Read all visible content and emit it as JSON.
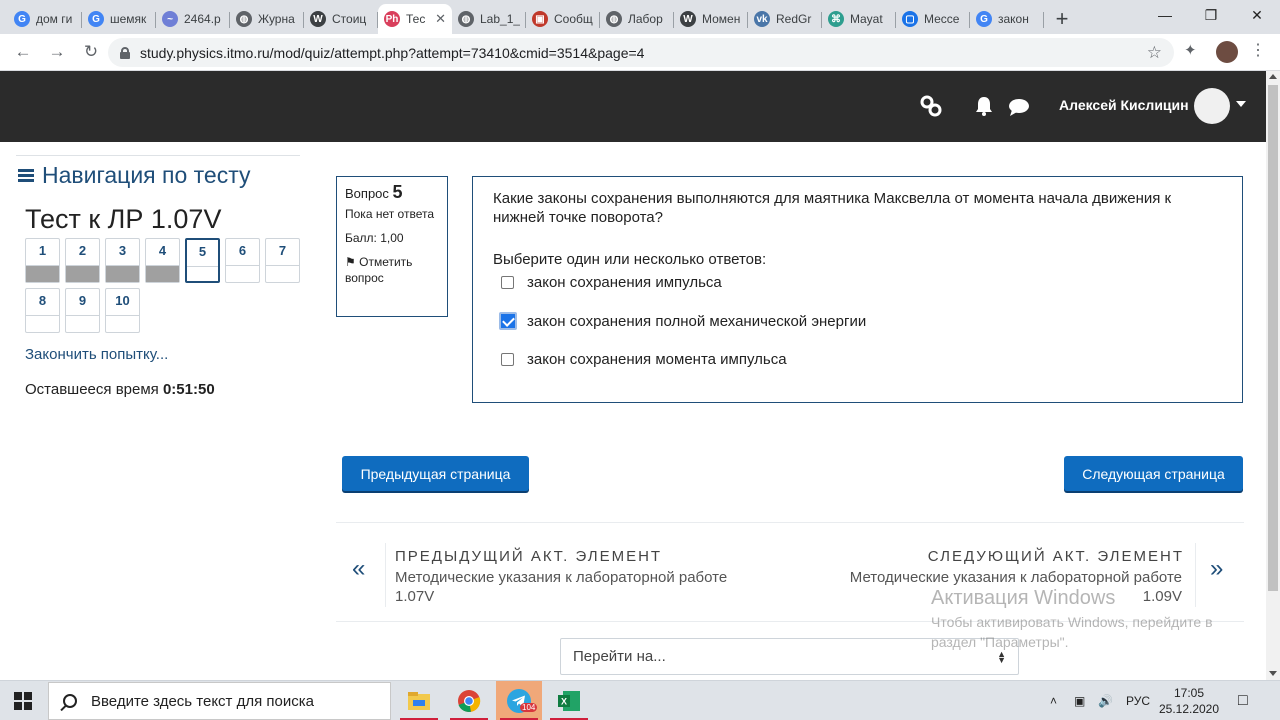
{
  "browser": {
    "tabs": [
      {
        "label": "дом ги",
        "icon": "google-icon",
        "color": "#4285f4",
        "glyph": "G"
      },
      {
        "label": "шемяк",
        "icon": "google-icon",
        "color": "#4285f4",
        "glyph": "G"
      },
      {
        "label": "2464.p",
        "icon": "wave-icon",
        "color": "#6f7fd6",
        "glyph": "~"
      },
      {
        "label": "Журна",
        "icon": "globe-icon",
        "color": "#5f6368",
        "glyph": "◍"
      },
      {
        "label": "Стоиц",
        "icon": "wikipedia-icon",
        "color": "#3c4043",
        "glyph": "W"
      },
      {
        "label": "Тес",
        "icon": "physics-icon",
        "color": "#d93f5c",
        "glyph": "Ph",
        "active": true
      },
      {
        "label": "Lab_1_",
        "icon": "globe-icon",
        "color": "#5f6368",
        "glyph": "◍"
      },
      {
        "label": "Сообщ",
        "icon": "book-icon",
        "color": "#c0392b",
        "glyph": "▣"
      },
      {
        "label": "Лабор",
        "icon": "globe-icon",
        "color": "#5f6368",
        "glyph": "◍"
      },
      {
        "label": "Момен",
        "icon": "wikipedia-icon",
        "color": "#3c4043",
        "glyph": "W"
      },
      {
        "label": "RedGr",
        "icon": "vk-icon",
        "color": "#4a76a8",
        "glyph": "vk"
      },
      {
        "label": "Mayat",
        "icon": "app-icon",
        "color": "#2e9e8f",
        "glyph": "⌘"
      },
      {
        "label": "Мессе",
        "icon": "messenger-icon",
        "color": "#1a73e8",
        "glyph": "▢"
      },
      {
        "label": "закон",
        "icon": "google-icon",
        "color": "#4285f4",
        "glyph": "G"
      }
    ],
    "url": "study.physics.itmo.ru/mod/quiz/attempt.php?attempt=73410&cmid=3514&page=4"
  },
  "header": {
    "user_name": "Алексей Кислицин"
  },
  "quiz_nav": {
    "title": "Навигация по тесту",
    "quiz_name": "Тест к ЛР 1.07V",
    "buttons": [
      {
        "num": "1",
        "state": "answered"
      },
      {
        "num": "2",
        "state": "answered"
      },
      {
        "num": "3",
        "state": "answered"
      },
      {
        "num": "4",
        "state": "answered"
      },
      {
        "num": "5",
        "state": "current"
      },
      {
        "num": "6",
        "state": "empty"
      },
      {
        "num": "7",
        "state": "empty"
      },
      {
        "num": "8",
        "state": "empty"
      },
      {
        "num": "9",
        "state": "empty"
      },
      {
        "num": "10",
        "state": "empty"
      }
    ],
    "finish_link": "Закончить попытку...",
    "time_label": "Оставшееся время",
    "time_value": "0:51:50"
  },
  "question_info": {
    "label": "Вопрос",
    "number": "5",
    "status": "Пока нет ответа",
    "grade": "Балл: 1,00",
    "flag": "Отметить вопрос"
  },
  "question": {
    "text": "Какие законы сохранения выполняются для маятника Максвелла от момента начала движения к нижней точке поворота?",
    "prompt": "Выберите один или несколько ответов:",
    "options": [
      {
        "label": "закон сохранения импульса",
        "checked": false
      },
      {
        "label": "закон сохранения полной механической энергии",
        "checked": true
      },
      {
        "label": "закон сохранения момента импульса",
        "checked": false
      }
    ]
  },
  "buttons": {
    "prev_page": "Предыдущая страница",
    "next_page": "Следующая страница"
  },
  "activity_nav": {
    "prev_heading": "ПРЕДЫДУЩИЙ АКТ. ЭЛЕМЕНТ",
    "prev_title_line1": "Методические указания к лабораторной работе",
    "prev_title_line2": "1.07V",
    "next_heading": "СЛЕДУЮЩИЙ АКТ. ЭЛЕМЕНТ",
    "next_title_line1": "Методические указания к лабораторной работе",
    "next_title_line2": "1.09V"
  },
  "jump_select": {
    "value": "Перейти на..."
  },
  "watermark": {
    "title": "Активация Windows",
    "text": "Чтобы активировать Windows, перейдите в раздел \"Параметры\"."
  },
  "taskbar": {
    "search_placeholder": "Введите здесь текст для поиска",
    "telegram_badge": "104",
    "language": "РУС",
    "time": "17:05",
    "date": "25.12.2020"
  },
  "colors": {
    "accent": "#0f6cbf",
    "nav_dark": "#2b2b2b",
    "link": "#1f4e79"
  }
}
